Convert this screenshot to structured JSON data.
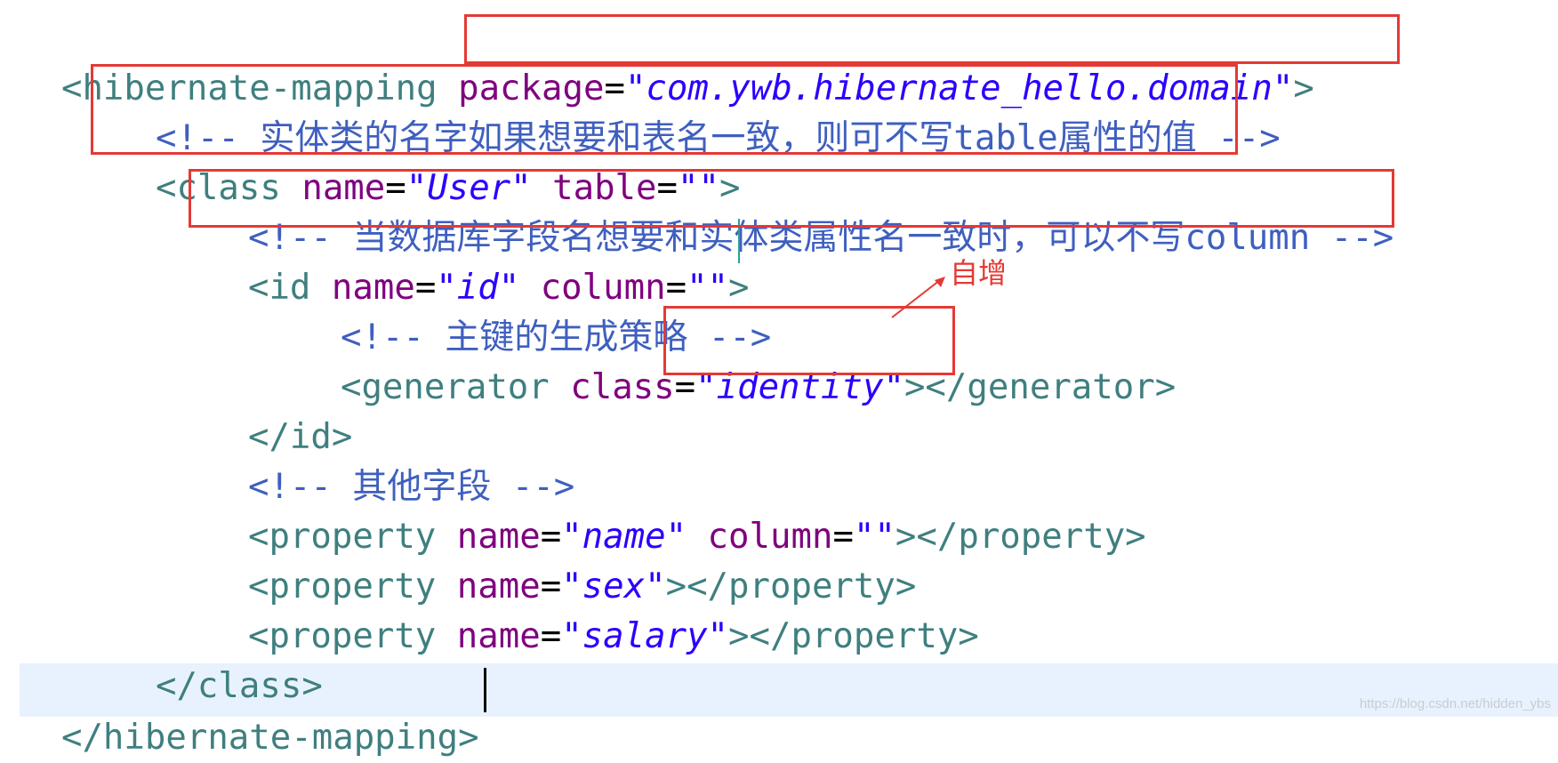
{
  "code": {
    "line1": {
      "open": "<hibernate-mapping ",
      "attr": "package",
      "eq": "=",
      "val": "\"com.ywb.hibernate_hello.domain\"",
      "close": ">"
    },
    "line2": {
      "comment": "<!-- 实体类的名字如果想要和表名一致，则可不写table属性的值 -->"
    },
    "line3": {
      "open": "<class ",
      "attr1": "name",
      "eq1": "=",
      "val1": "\"User\"",
      "attr2": " table",
      "eq2": "=",
      "val2": "\"\"",
      "close": ">"
    },
    "line4": {
      "comment": "<!-- 当数据库字段名想要和实体类属性名一致时，可以不写column -->"
    },
    "line5": {
      "open": "<id ",
      "attr1": "name",
      "eq1": "=",
      "val1": "\"id\"",
      "attr2": " column",
      "eq2": "=",
      "val2": "\"\"",
      "close": ">"
    },
    "line6": {
      "comment": "<!-- 主键的生成策略 -->"
    },
    "line7": {
      "open": "<generator ",
      "attr": "class",
      "eq": "=",
      "val": "\"identity\"",
      "close": "></generator>"
    },
    "line8": {
      "text": "</id>"
    },
    "line9": {
      "comment": "<!-- 其他字段 -->"
    },
    "line10": {
      "open": "<property ",
      "attr1": "name",
      "eq1": "=",
      "val1": "\"name\"",
      "attr2": " column",
      "eq2": "=",
      "val2": "\"\"",
      "close": "></property>"
    },
    "line11": {
      "open": "<property ",
      "attr": "name",
      "eq": "=",
      "val": "\"sex\"",
      "close": "></property>"
    },
    "line12": {
      "open": "<property ",
      "attr": "name",
      "eq": "=",
      "val": "\"salary\"",
      "close": "></property>"
    },
    "line13": {
      "text": "</class>"
    },
    "line14": {
      "text": "</hibernate-mapping>"
    }
  },
  "annotation": {
    "label": "自增"
  },
  "watermark": "https://blog.csdn.net/hidden_ybs",
  "colors": {
    "tag": "#3f7f7f",
    "attribute": "#7f007f",
    "string": "#2a00ff",
    "comment": "#3f5fbf",
    "highlight_box": "#e53935",
    "current_line": "#e8f2fe"
  }
}
